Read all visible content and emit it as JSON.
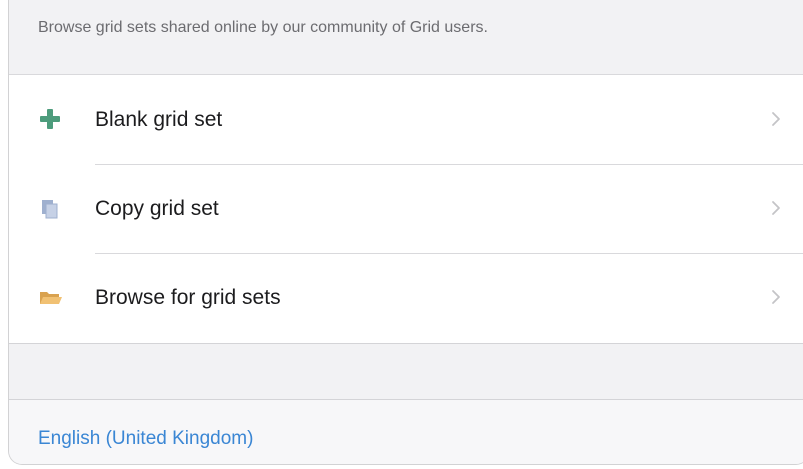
{
  "header": {
    "description": "Browse grid sets shared online by our community of Grid users."
  },
  "list": {
    "items": [
      {
        "label": "Blank grid set",
        "icon": "plus-icon",
        "icon_color": "#4d9c7c"
      },
      {
        "label": "Copy grid set",
        "icon": "copy-icon",
        "icon_color": "#8a9bbf"
      },
      {
        "label": "Browse for grid sets",
        "icon": "folder-icon",
        "icon_color": "#e9b463"
      }
    ]
  },
  "footer": {
    "language": "English (United Kingdom)",
    "link_color": "#3a86d4"
  }
}
